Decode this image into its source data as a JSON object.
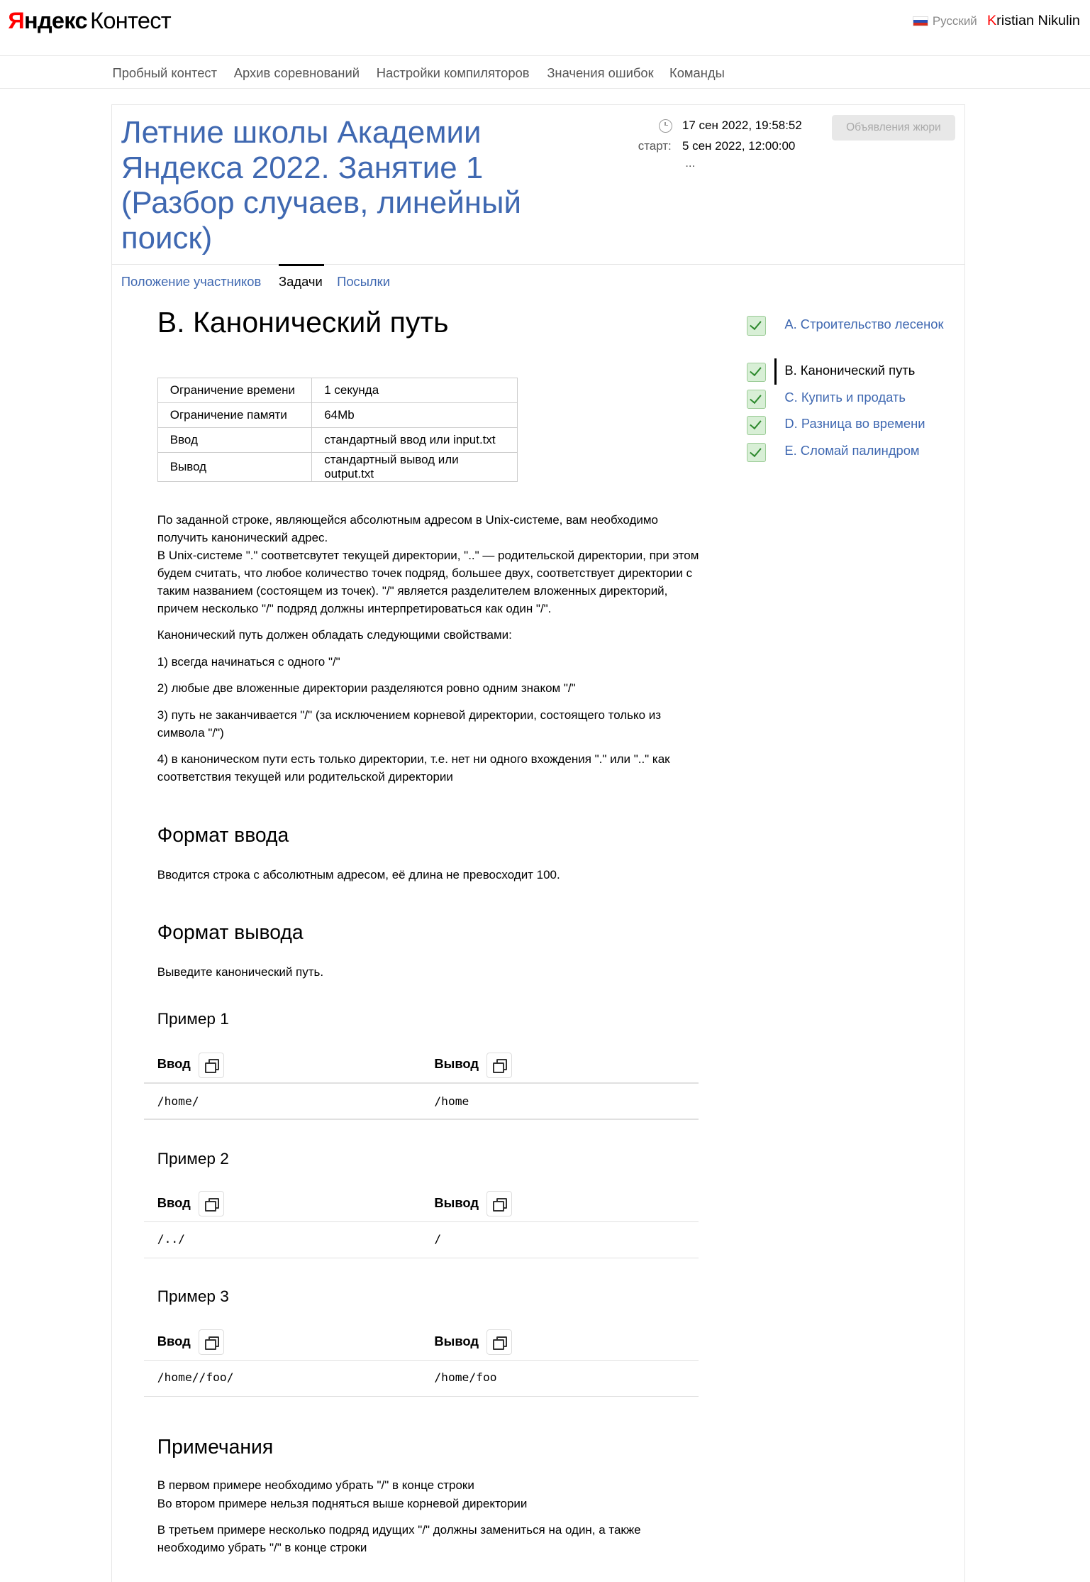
{
  "header": {
    "logo_brand": "Яндекс",
    "logo_product": "Контест",
    "language": "Русский",
    "user_first_letter": "K",
    "user_rest": "ristian Nikulin"
  },
  "nav": [
    "Пробный контест",
    "Архив соревнований",
    "Настройки компиляторов",
    "Значения ошибок",
    "Команды"
  ],
  "contest": {
    "title": "Летние школы Академии Яндекса 2022. Занятие 1 (Разбор случаев, линейный поиск)",
    "current_time": "17 сен 2022, 19:58:52",
    "start_label": "старт:",
    "start_time": "5 сен 2022, 12:00:00",
    "dots": "...",
    "jury_button": "Объявления жюри",
    "tabs": [
      "Положение участников",
      "Задачи",
      "Посылки"
    ]
  },
  "problem": {
    "title": "B. Канонический путь",
    "limits": [
      {
        "k": "Ограничение времени",
        "v": "1 секунда"
      },
      {
        "k": "Ограничение памяти",
        "v": "64Mb"
      },
      {
        "k": "Ввод",
        "v": "стандартный ввод или input.txt"
      },
      {
        "k": "Вывод",
        "v": "стандартный вывод или output.txt"
      }
    ],
    "statement_p1": "По заданной строке, являющейся абсолютным адресом в Unix-системе, вам необходимо получить канонический адрес.",
    "statement_p2": "В Unix-системе \".\" соответсвутет текущей директории, \"..\" — родительской директории, при этом будем считать, что любое количество точек подряд, большее двух, соответствует директории с таким названием (состоящем из точек). \"/\" является разделителем вложенных директорий, причем несколько \"/\" подряд должны интерпретироваться как один \"/\".",
    "statement_p3": "Канонический путь должен обладать следующими свойствами:",
    "rule_1": "1) всегда начинаться с одного \"/\"",
    "rule_2": "2) любые две вложенные директории разделяются ровно одним знаком \"/\"",
    "rule_3": "3) путь не заканчивается \"/\" (за исключением корневой директории, состоящего только из символа \"/\")",
    "rule_4": "4) в каноническом пути есть только директории, т.е. нет ни одного вхождения \".\" или \"..\" как соответствия текущей или родительской директории",
    "input_heading": "Формат ввода",
    "input_text": "Вводится строка с абсолютным адресом, её длина не превосходит 100.",
    "output_heading": "Формат вывода",
    "output_text": "Выведите канонический путь.",
    "examples": [
      {
        "title": "Пример 1",
        "in_label": "Ввод",
        "out_label": "Вывод",
        "in": "/home/",
        "out": "/home"
      },
      {
        "title": "Пример 2",
        "in_label": "Ввод",
        "out_label": "Вывод",
        "in": "/../",
        "out": "/"
      },
      {
        "title": "Пример 3",
        "in_label": "Ввод",
        "out_label": "Вывод",
        "in": "/home//foo/",
        "out": "/home/foo"
      }
    ],
    "notes_heading": "Примечания",
    "note_1": "В первом примере необходимо убрать \"/\" в конце строки",
    "note_2": "Во втором примере нельзя подняться выше корневой директории",
    "note_3": "В третьем примере несколько подряд идущих \"/\" должны замениться на один, а также необходимо убрать \"/\" в конце строки"
  },
  "problem_list": [
    {
      "label": "A. Строительство лесенок",
      "status": "accepted"
    },
    {
      "label": "B. Канонический путь",
      "status": "accepted"
    },
    {
      "label": "C. Купить и продать",
      "status": "accepted"
    },
    {
      "label": "D. Разница во времени",
      "status": "accepted"
    },
    {
      "label": "E. Сломай палиндром",
      "status": "accepted"
    }
  ],
  "colors": {
    "link": "#3f68b1",
    "brand_red": "#ff0000",
    "check_bg": "#d8efd6"
  }
}
